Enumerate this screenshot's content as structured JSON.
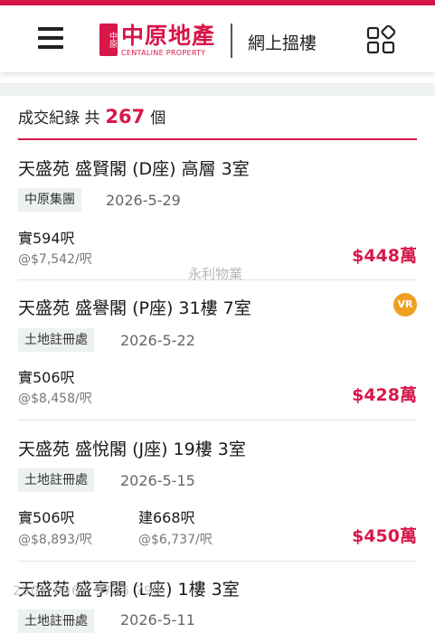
{
  "header": {
    "logo_cn": "中原地產",
    "logo_en": "CENTALINE PROPERTY",
    "logo_seal": "中原",
    "site_title": "網上搵樓",
    "brand_color": "#d8174a"
  },
  "summary": {
    "prefix": "成交紀錄 共",
    "count": "267",
    "suffix": "個"
  },
  "watermark": "永利物業",
  "watermark2": "2507 0967 9736 799",
  "listings": [
    {
      "title": "天盛苑 盛賢閣 (D座) 高層 3室",
      "source": "中原集團",
      "date": "2026-5-29",
      "saleable_area": "實594呎",
      "saleable_unit_price": "@$7,542/呎",
      "price": "$448萬"
    },
    {
      "title": "天盛苑 盛譽閣 (P座) 31樓 7室",
      "source": "土地註冊處",
      "date": "2026-5-22",
      "saleable_area": "實506呎",
      "saleable_unit_price": "@$8,458/呎",
      "price": "$428萬",
      "vr_badge": "VR"
    },
    {
      "title": "天盛苑 盛悅閣 (J座) 19樓 3室",
      "source": "土地註冊處",
      "date": "2026-5-15",
      "saleable_area": "實506呎",
      "saleable_unit_price": "@$8,893/呎",
      "gross_area": "建668呎",
      "gross_unit_price": "@$6,737/呎",
      "price": "$450萬"
    },
    {
      "title": "天盛苑 盛亨閣 (L座) 1樓 3室",
      "source": "土地註冊處",
      "date": "2026-5-11"
    }
  ]
}
